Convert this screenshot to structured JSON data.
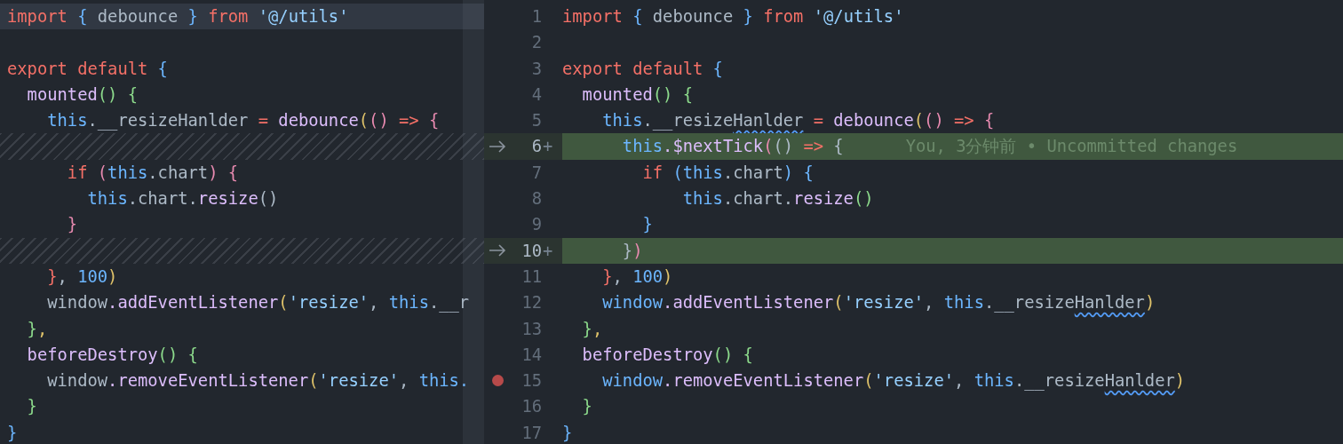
{
  "left_pane": {
    "lines": [
      {
        "kind": "code",
        "current": true,
        "tokens": [
          {
            "kind": "k",
            "text": "import "
          },
          {
            "kind": "b",
            "text": "{ "
          },
          {
            "kind": "p",
            "text": "debounce "
          },
          {
            "kind": "b",
            "text": "} "
          },
          {
            "kind": "k",
            "text": "from "
          },
          {
            "kind": "s",
            "text": "'@/utils'"
          }
        ]
      },
      {
        "kind": "code",
        "current": false
      },
      {
        "kind": "code",
        "current": false,
        "tokens": [
          {
            "kind": "k",
            "text": "export default "
          },
          {
            "kind": "b",
            "text": "{"
          }
        ]
      },
      {
        "kind": "code",
        "current": false,
        "tokens": [
          {
            "kind": "f",
            "text": "  mounted"
          },
          {
            "kind": "g",
            "text": "() {"
          }
        ]
      },
      {
        "kind": "code",
        "current": false,
        "tokens": [
          {
            "kind": "t",
            "text": "    this"
          },
          {
            "kind": "p",
            "text": ".__resizeHanlder "
          },
          {
            "kind": "o",
            "text": "= "
          },
          {
            "kind": "f",
            "text": "debounce"
          },
          {
            "kind": "y",
            "text": "("
          },
          {
            "kind": "m",
            "text": "() "
          },
          {
            "kind": "o",
            "text": "=> "
          },
          {
            "kind": "m",
            "text": "{"
          }
        ]
      },
      {
        "kind": "filler",
        "current": false
      },
      {
        "kind": "code",
        "current": false,
        "tokens": [
          {
            "kind": "k",
            "text": "      if "
          },
          {
            "kind": "m",
            "text": "("
          },
          {
            "kind": "t",
            "text": "this"
          },
          {
            "kind": "p",
            "text": ".chart"
          },
          {
            "kind": "m",
            "text": ") {"
          }
        ]
      },
      {
        "kind": "code",
        "current": false,
        "tokens": [
          {
            "kind": "t",
            "text": "        this"
          },
          {
            "kind": "p",
            "text": ".chart."
          },
          {
            "kind": "f",
            "text": "resize"
          },
          {
            "kind": "p",
            "text": "()"
          }
        ]
      },
      {
        "kind": "code",
        "current": false,
        "tokens": [
          {
            "kind": "m",
            "text": "      }"
          }
        ]
      },
      {
        "kind": "filler",
        "current": false
      },
      {
        "kind": "code",
        "current": false,
        "tokens": [
          {
            "kind": "o",
            "text": "    }"
          },
          {
            "kind": "p",
            "text": ", "
          },
          {
            "kind": "n",
            "text": "100"
          },
          {
            "kind": "y",
            "text": ")"
          }
        ]
      },
      {
        "kind": "code",
        "current": false,
        "tokens": [
          {
            "kind": "p",
            "text": "    window"
          },
          {
            "kind": "f",
            "text": ".addEventListener"
          },
          {
            "kind": "y",
            "text": "("
          },
          {
            "kind": "s",
            "text": "'resize'"
          },
          {
            "kind": "p",
            "text": ", "
          },
          {
            "kind": "t",
            "text": "this"
          },
          {
            "kind": "p",
            "text": ".__r"
          }
        ]
      },
      {
        "kind": "code",
        "current": false,
        "tokens": [
          {
            "kind": "g",
            "text": "  }"
          },
          {
            "kind": "y",
            "text": ","
          }
        ]
      },
      {
        "kind": "code",
        "current": false,
        "tokens": [
          {
            "kind": "f",
            "text": "  beforeDestroy"
          },
          {
            "kind": "g",
            "text": "() {"
          }
        ]
      },
      {
        "kind": "code",
        "current": false,
        "tokens": [
          {
            "kind": "p",
            "text": "    window"
          },
          {
            "kind": "f",
            "text": ".removeEventListener"
          },
          {
            "kind": "y",
            "text": "("
          },
          {
            "kind": "s",
            "text": "'resize'"
          },
          {
            "kind": "p",
            "text": ", "
          },
          {
            "kind": "t",
            "text": "this."
          }
        ]
      },
      {
        "kind": "code",
        "current": false,
        "tokens": [
          {
            "kind": "g",
            "text": "  }"
          }
        ]
      },
      {
        "kind": "code",
        "current": false,
        "tokens": [
          {
            "kind": "b",
            "text": "}"
          }
        ]
      }
    ]
  },
  "right_pane": {
    "lines": [
      {
        "number": "1",
        "added": false,
        "breakpoint": false,
        "tokens": [
          {
            "kind": "k",
            "text": "import "
          },
          {
            "kind": "b",
            "text": "{ "
          },
          {
            "kind": "p",
            "text": "debounce "
          },
          {
            "kind": "b",
            "text": "} "
          },
          {
            "kind": "k",
            "text": "from "
          },
          {
            "kind": "s",
            "text": "'@/utils'"
          }
        ]
      },
      {
        "number": "2",
        "added": false,
        "breakpoint": false
      },
      {
        "number": "3",
        "added": false,
        "breakpoint": false,
        "tokens": [
          {
            "kind": "k",
            "text": "export default "
          },
          {
            "kind": "b",
            "text": "{"
          }
        ]
      },
      {
        "number": "4",
        "added": false,
        "breakpoint": false,
        "tokens": [
          {
            "kind": "f",
            "text": "  mounted"
          },
          {
            "kind": "g",
            "text": "() {"
          }
        ]
      },
      {
        "number": "5",
        "added": false,
        "breakpoint": false,
        "tokens": [
          {
            "kind": "t",
            "text": "    this"
          },
          {
            "kind": "p",
            "text": ".__resize"
          },
          {
            "kind": "w",
            "text": "Hanlder"
          },
          {
            "kind": "o",
            "text": " = "
          },
          {
            "kind": "f",
            "text": "debounce"
          },
          {
            "kind": "y",
            "text": "("
          },
          {
            "kind": "m",
            "text": "() "
          },
          {
            "kind": "o",
            "text": "=> "
          },
          {
            "kind": "m",
            "text": "{"
          }
        ]
      },
      {
        "number": "6",
        "added": true,
        "breakpoint": false,
        "marker": "+",
        "blame": "You, 3分钟前 • Uncommitted changes",
        "tokens": [
          {
            "kind": "t",
            "text": "      this"
          },
          {
            "kind": "f",
            "text": ".$nextTick"
          },
          {
            "kind": "m",
            "text": "("
          },
          {
            "kind": "p",
            "text": "() "
          },
          {
            "kind": "o",
            "text": "=> "
          },
          {
            "kind": "p",
            "text": "{"
          }
        ]
      },
      {
        "number": "7",
        "added": false,
        "breakpoint": false,
        "tokens": [
          {
            "kind": "k",
            "text": "        if "
          },
          {
            "kind": "b",
            "text": "("
          },
          {
            "kind": "t",
            "text": "this"
          },
          {
            "kind": "p",
            "text": ".chart"
          },
          {
            "kind": "b",
            "text": ") {"
          }
        ]
      },
      {
        "number": "8",
        "added": false,
        "breakpoint": false,
        "tokens": [
          {
            "kind": "t",
            "text": "            this"
          },
          {
            "kind": "p",
            "text": ".chart."
          },
          {
            "kind": "f",
            "text": "resize"
          },
          {
            "kind": "g",
            "text": "()"
          }
        ]
      },
      {
        "number": "9",
        "added": false,
        "breakpoint": false,
        "tokens": [
          {
            "kind": "b",
            "text": "        }"
          }
        ]
      },
      {
        "number": "10",
        "added": true,
        "breakpoint": false,
        "marker": "+",
        "tokens": [
          {
            "kind": "p",
            "text": "      }"
          },
          {
            "kind": "m",
            "text": ")"
          }
        ]
      },
      {
        "number": "11",
        "added": false,
        "breakpoint": false,
        "tokens": [
          {
            "kind": "o",
            "text": "    }"
          },
          {
            "kind": "p",
            "text": ", "
          },
          {
            "kind": "n",
            "text": "100"
          },
          {
            "kind": "y",
            "text": ")"
          }
        ]
      },
      {
        "number": "12",
        "added": false,
        "breakpoint": false,
        "tokens": [
          {
            "kind": "t",
            "text": "    window"
          },
          {
            "kind": "f",
            "text": ".addEventListener"
          },
          {
            "kind": "y",
            "text": "("
          },
          {
            "kind": "s",
            "text": "'resize'"
          },
          {
            "kind": "p",
            "text": ", "
          },
          {
            "kind": "t",
            "text": "this"
          },
          {
            "kind": "p",
            "text": ".__resize"
          },
          {
            "kind": "w",
            "text": "Hanlder"
          },
          {
            "kind": "y",
            "text": ")"
          }
        ]
      },
      {
        "number": "13",
        "added": false,
        "breakpoint": false,
        "tokens": [
          {
            "kind": "g",
            "text": "  }"
          },
          {
            "kind": "y",
            "text": ","
          }
        ]
      },
      {
        "number": "14",
        "added": false,
        "breakpoint": false,
        "tokens": [
          {
            "kind": "f",
            "text": "  beforeDestroy"
          },
          {
            "kind": "g",
            "text": "() {"
          }
        ]
      },
      {
        "number": "15",
        "added": false,
        "breakpoint": true,
        "tokens": [
          {
            "kind": "t",
            "text": "    window"
          },
          {
            "kind": "f",
            "text": ".removeEventListener"
          },
          {
            "kind": "y",
            "text": "("
          },
          {
            "kind": "s",
            "text": "'resize'"
          },
          {
            "kind": "p",
            "text": ", "
          },
          {
            "kind": "t",
            "text": "this"
          },
          {
            "kind": "p",
            "text": ".__resize"
          },
          {
            "kind": "w",
            "text": "Hanlder"
          },
          {
            "kind": "y",
            "text": ")"
          }
        ]
      },
      {
        "number": "16",
        "added": false,
        "breakpoint": false,
        "tokens": [
          {
            "kind": "g",
            "text": "  }"
          }
        ]
      },
      {
        "number": "17",
        "added": false,
        "breakpoint": false,
        "tokens": [
          {
            "kind": "b",
            "text": "}"
          }
        ]
      }
    ]
  }
}
